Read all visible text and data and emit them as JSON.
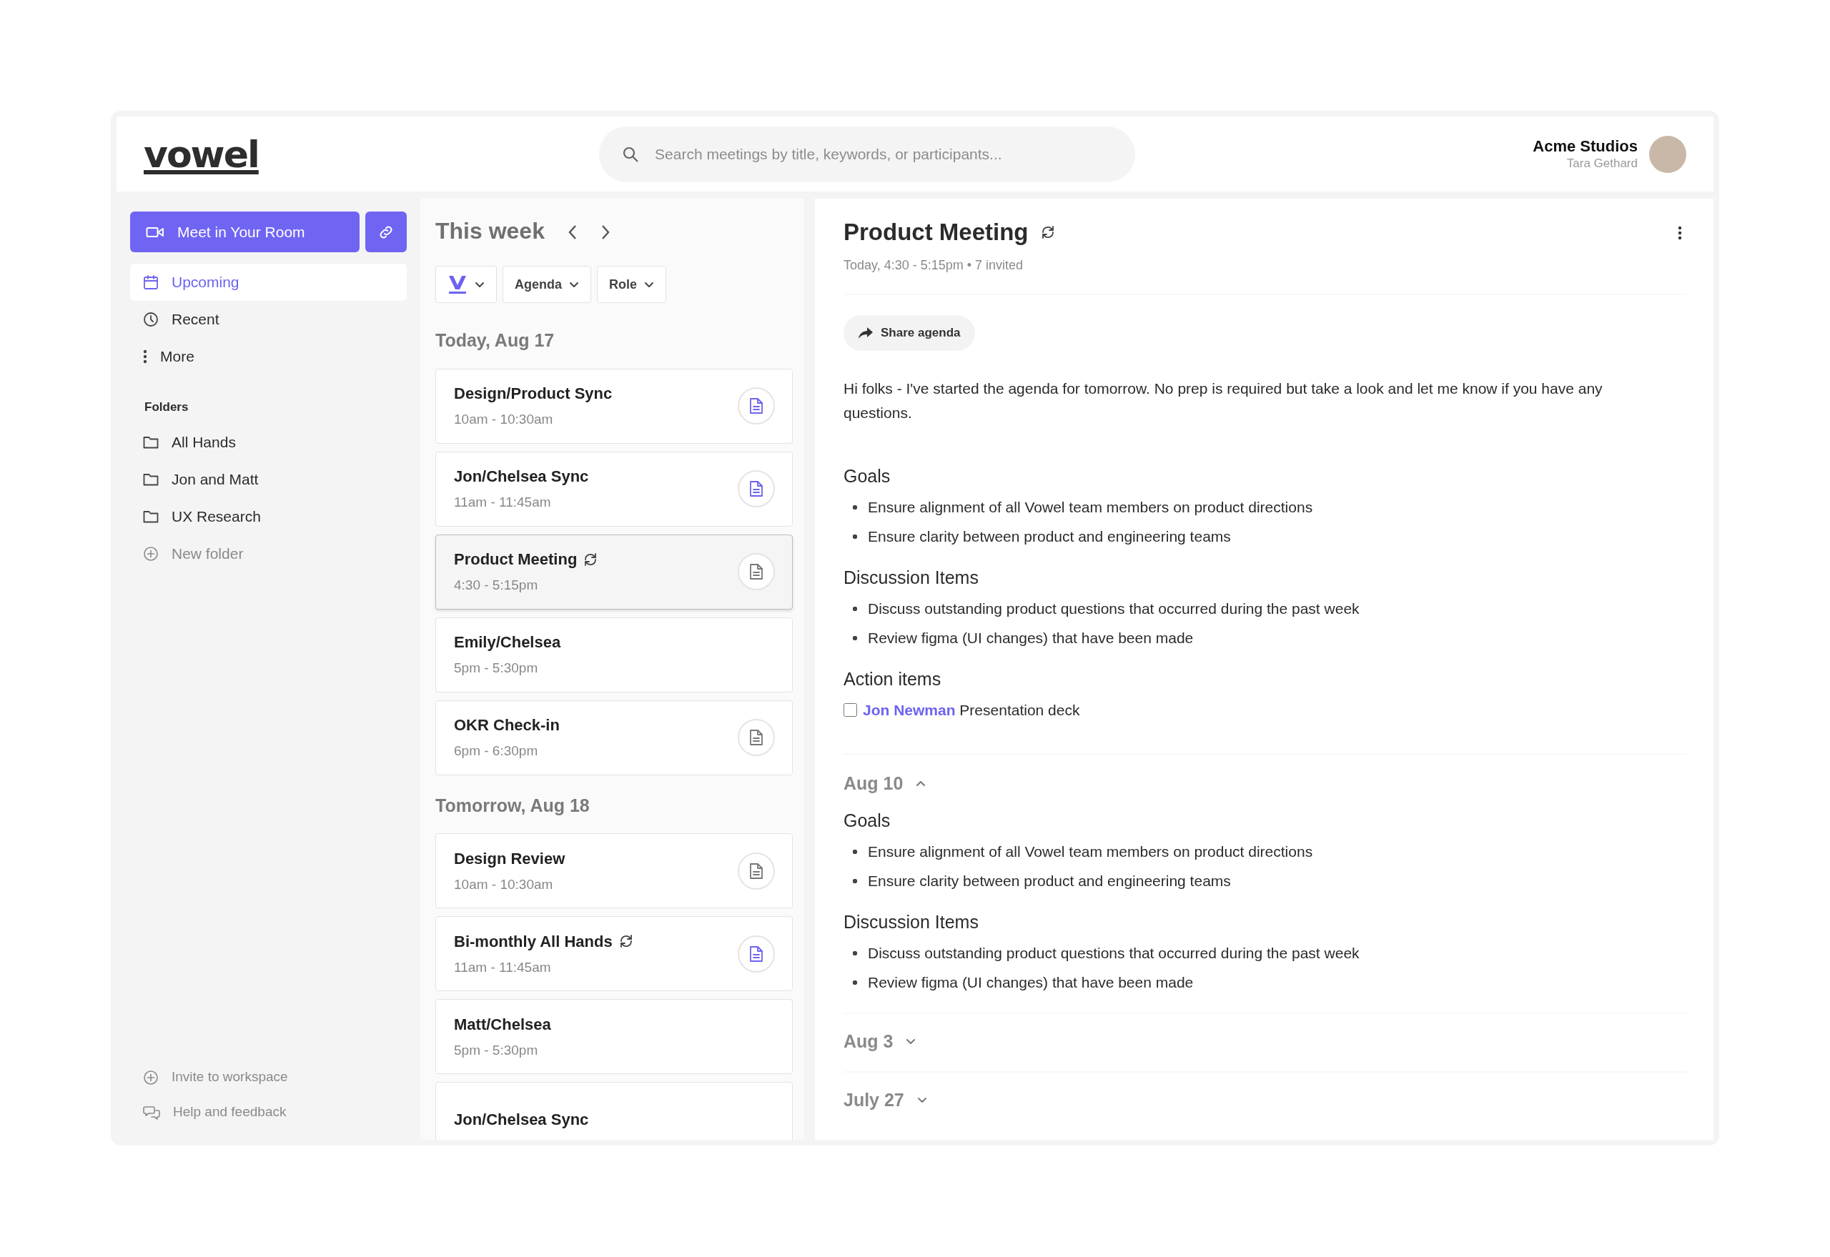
{
  "logo": {
    "text": "vowel"
  },
  "search": {
    "placeholder": "Search meetings by title, keywords, or participants..."
  },
  "account": {
    "workspace": "Acme Studios",
    "user": "Tara Gethard"
  },
  "sidebar": {
    "primary_button": "Meet in Your Room",
    "nav": [
      {
        "label": "Upcoming",
        "selected": true
      },
      {
        "label": "Recent",
        "selected": false
      },
      {
        "label": "More",
        "selected": false
      }
    ],
    "folders_heading": "Folders",
    "folders": [
      {
        "label": "All Hands",
        "kind": "folder"
      },
      {
        "label": "Jon and Matt",
        "kind": "folder"
      },
      {
        "label": "UX Research",
        "kind": "folder"
      },
      {
        "label": "New folder",
        "kind": "add"
      }
    ],
    "footer": [
      {
        "label": "Invite to workspace",
        "kind": "add"
      },
      {
        "label": "Help and feedback",
        "kind": "chat"
      }
    ]
  },
  "meetings_list": {
    "title": "This week",
    "filters": [
      {
        "kind": "logo"
      },
      {
        "kind": "text",
        "label": "Agenda"
      },
      {
        "kind": "text",
        "label": "Role"
      }
    ],
    "days": [
      {
        "heading": "Today, Aug 17",
        "meetings": [
          {
            "title": "Design/Product Sync",
            "time": "10am - 10:30am",
            "recurring": false,
            "agenda_button": true,
            "agenda_highlighted": true,
            "selected": false
          },
          {
            "title": "Jon/Chelsea Sync",
            "time": "11am - 11:45am",
            "recurring": false,
            "agenda_button": true,
            "agenda_highlighted": true,
            "selected": false
          },
          {
            "title": "Product Meeting",
            "time": "4:30 - 5:15pm",
            "recurring": true,
            "agenda_button": true,
            "agenda_highlighted": false,
            "selected": true
          },
          {
            "title": "Emily/Chelsea",
            "time": "5pm - 5:30pm",
            "recurring": false,
            "agenda_button": false,
            "selected": false
          },
          {
            "title": "OKR Check-in",
            "time": "6pm - 6:30pm",
            "recurring": false,
            "agenda_button": true,
            "agenda_highlighted": false,
            "selected": false
          }
        ]
      },
      {
        "heading": "Tomorrow, Aug 18",
        "meetings": [
          {
            "title": "Design Review",
            "time": "10am - 10:30am",
            "recurring": false,
            "agenda_button": true,
            "agenda_highlighted": false,
            "selected": false
          },
          {
            "title": "Bi-monthly All Hands",
            "time": "11am - 11:45am",
            "recurring": true,
            "agenda_button": true,
            "agenda_highlighted": true,
            "selected": false
          },
          {
            "title": "Matt/Chelsea",
            "time": "5pm - 5:30pm",
            "recurring": false,
            "agenda_button": false,
            "selected": false
          },
          {
            "title": "Jon/Chelsea Sync",
            "recurring": false,
            "agenda_button": false,
            "selected": false
          }
        ]
      }
    ]
  },
  "detail": {
    "title": "Product Meeting",
    "recurring": true,
    "meta": "Today, 4:30 - 5:15pm • 7 invited",
    "share_button": "Share agenda",
    "intro": "Hi folks - I've started the agenda for tomorrow. No prep is required but take a look and let me know if you have any questions.",
    "sections": [
      {
        "kind": "bullets",
        "heading": "Goals",
        "items": [
          "Ensure alignment of all Vowel team members on product directions",
          "Ensure clarity between product and engineering teams"
        ]
      },
      {
        "kind": "bullets",
        "heading": "Discussion Items",
        "items": [
          "Discuss outstanding product questions that occurred during the past week",
          "Review figma (UI changes) that have been made"
        ]
      },
      {
        "kind": "actions",
        "heading": "Action items",
        "actions": [
          {
            "assignee": "Jon Newman",
            "text": "Presentation deck",
            "checked": false
          }
        ]
      }
    ],
    "past": [
      {
        "date": "Aug 10",
        "expanded": true,
        "sections": [
          {
            "kind": "bullets",
            "heading": "Goals",
            "items": [
              "Ensure alignment of all Vowel team members on product directions",
              "Ensure clarity between product and engineering teams"
            ]
          },
          {
            "kind": "bullets",
            "heading": "Discussion Items",
            "items": [
              "Discuss outstanding product questions that occurred during the past week",
              "Review figma (UI changes) that have been made"
            ]
          }
        ]
      },
      {
        "date": "Aug 3",
        "expanded": false
      },
      {
        "date": "July 27",
        "expanded": false
      }
    ]
  }
}
